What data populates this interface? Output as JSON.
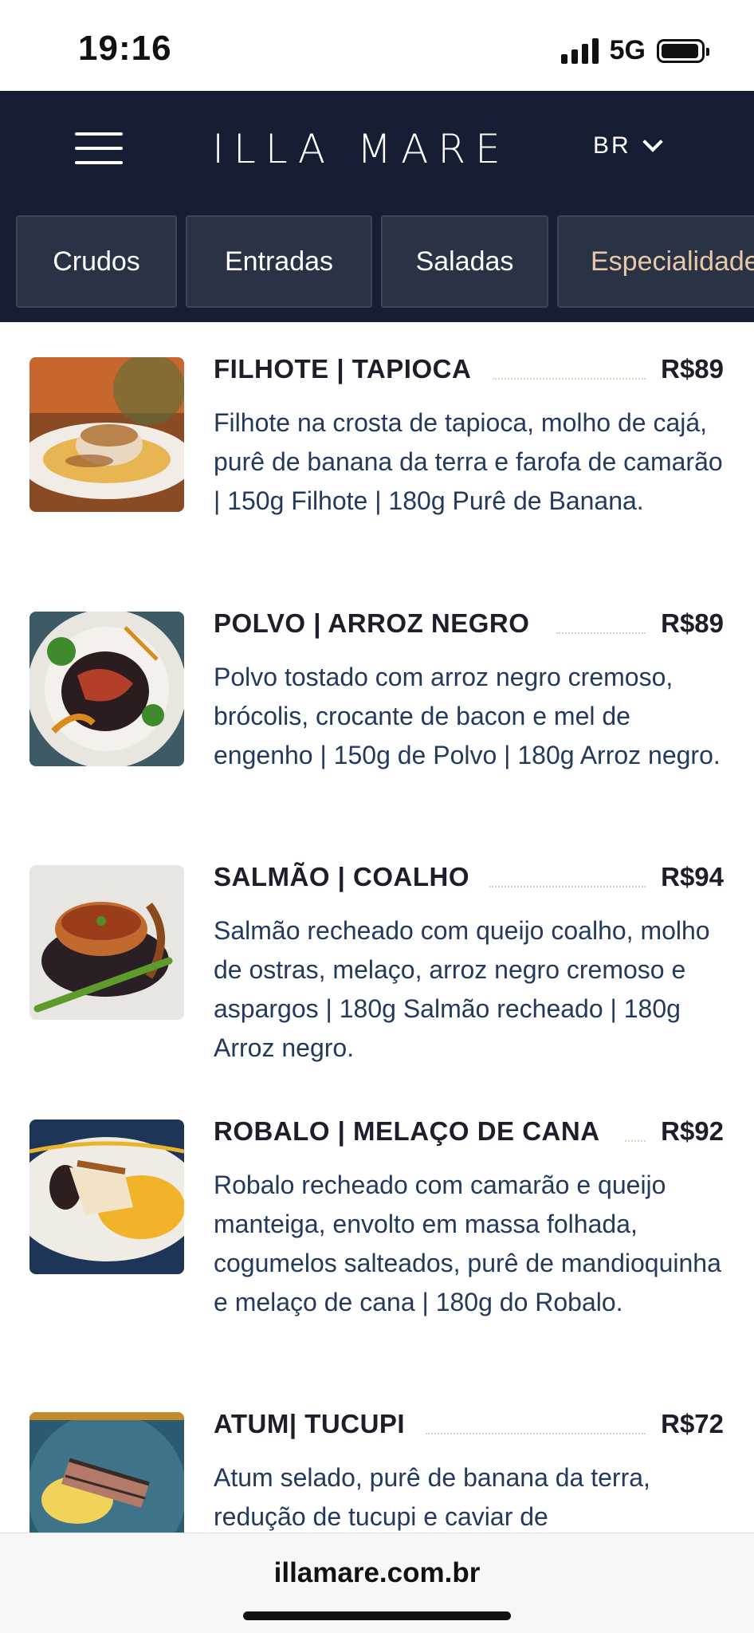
{
  "status_bar": {
    "time": "19:16",
    "network": "5G"
  },
  "header": {
    "logo": "ILLA MARE",
    "language": "BR"
  },
  "tabs": [
    {
      "label": "Crudos"
    },
    {
      "label": "Entradas"
    },
    {
      "label": "Saladas"
    },
    {
      "label": "Especialidades"
    }
  ],
  "menu": [
    {
      "name": "FILHOTE | TAPIOCA",
      "price": "R$89",
      "description": "Filhote na crosta de tapioca, molho de cajá, purê de banana da terra e farofa de camarão | 150g Filhote | 180g Purê de Banana."
    },
    {
      "name": "POLVO | ARROZ NEGRO",
      "price": "R$89",
      "description": "Polvo tostado com arroz negro cremoso, brócolis, crocante de bacon e mel de engenho | 150g de Polvo | 180g Arroz negro."
    },
    {
      "name": "SALMÃO | COALHO",
      "price": "R$94",
      "description": "Salmão recheado com queijo coalho, molho de ostras, melaço, arroz negro cremoso e aspargos | 180g Salmão recheado | 180g Arroz negro."
    },
    {
      "name": "ROBALO | MELAÇO DE CANA",
      "price": "R$92",
      "description": "Robalo recheado com camarão e queijo manteiga, envolto em massa folhada, cogumelos salteados, purê de mandioquinha e melaço de cana | 180g do Robalo."
    },
    {
      "name": "ATUM| TUCUPI",
      "price": "R$72",
      "description": "Atum selado, purê de banana da terra, redução de tucupi e caviar de"
    }
  ],
  "browser": {
    "url": "illamare.com.br"
  },
  "colors": {
    "header_bg": "#151e32",
    "tab_bg": "#2a3345",
    "active_tab_text": "#e9c9a4",
    "description_text": "#233a5c"
  }
}
